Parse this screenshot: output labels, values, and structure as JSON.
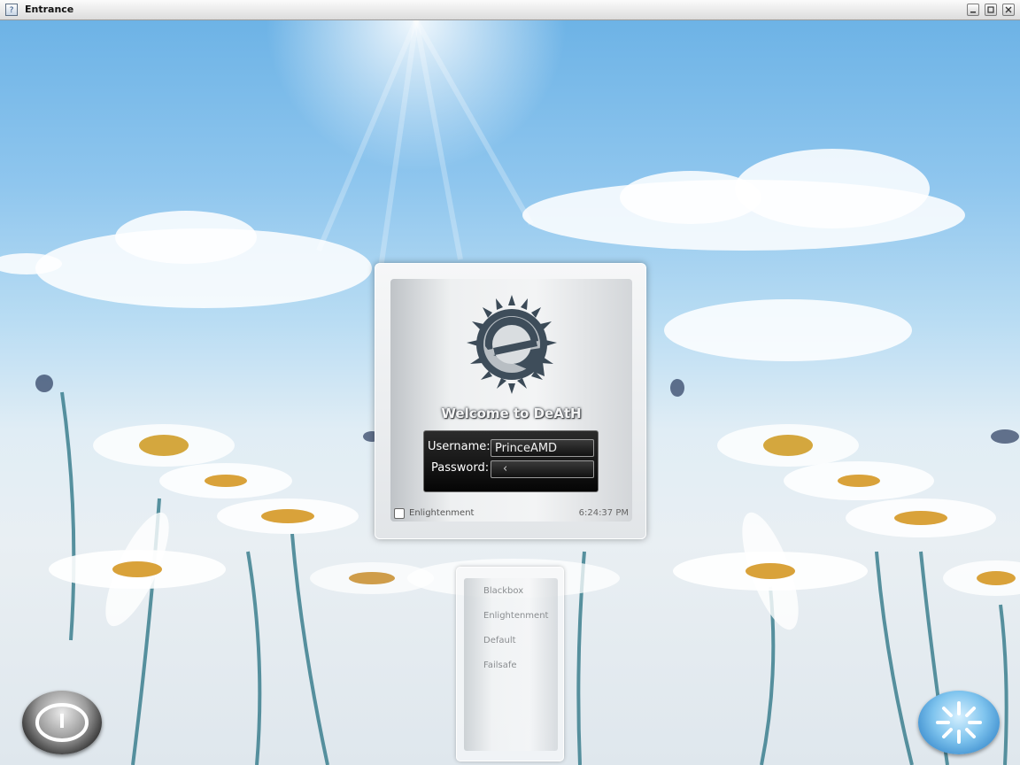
{
  "window": {
    "title": "Entrance",
    "icon": "question-mark-app-icon",
    "controls": [
      "minimize-icon",
      "maximize-icon",
      "close-icon"
    ]
  },
  "login": {
    "welcome": "Welcome to DeAtH",
    "username_label": "Username:",
    "username_value": "PrinceAMD",
    "password_label": "Password:",
    "password_value": "",
    "selected_session": "Enlightenment",
    "clock": "6:24:37 PM",
    "logo": "enlightenment-logo"
  },
  "sessions": {
    "items": [
      "Blackbox",
      "Enlightenment",
      "Default",
      "Failsafe"
    ]
  },
  "actions": {
    "power_icon": "power-icon",
    "reboot_icon": "reboot-icon"
  },
  "colors": {
    "sky": "#6db3e6",
    "form_bg": "#0a0a0a",
    "reboot_blue": "#3f8fcf"
  }
}
